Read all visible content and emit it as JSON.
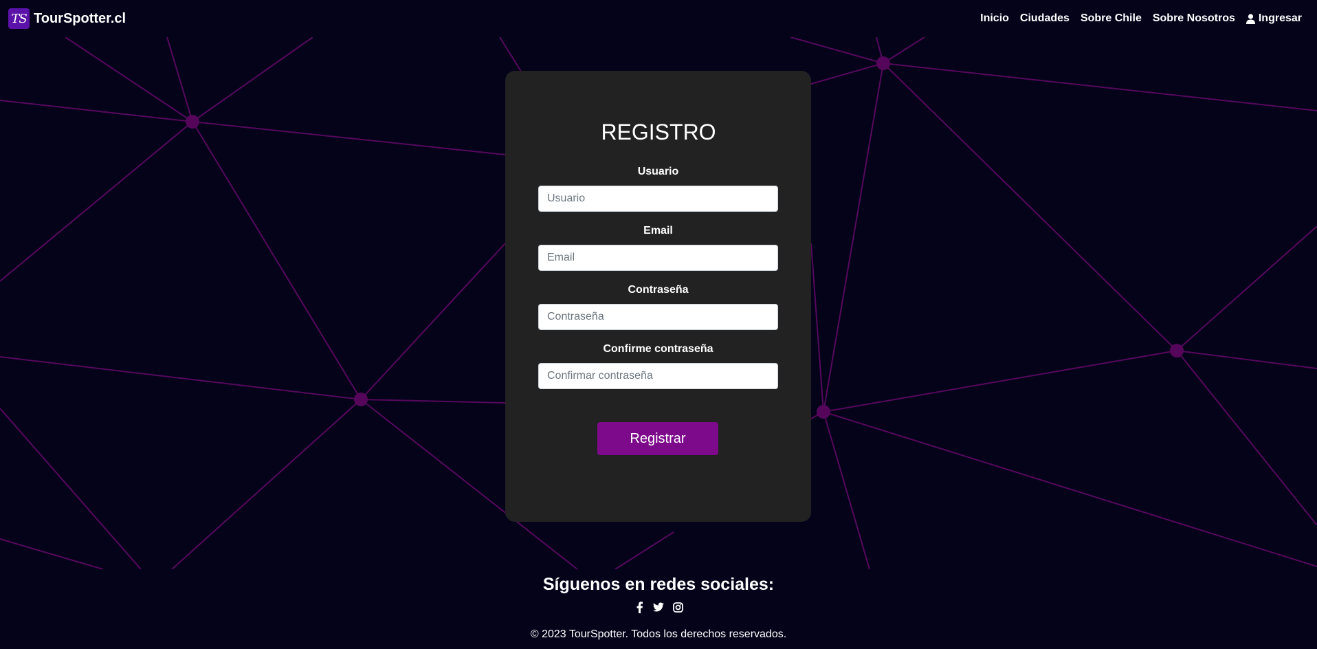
{
  "brand": {
    "logo_text": "TS",
    "name": "TourSpotter.cl"
  },
  "nav": {
    "items": [
      {
        "label": "Inicio"
      },
      {
        "label": "Ciudades"
      },
      {
        "label": "Sobre Chile"
      },
      {
        "label": "Sobre Nosotros"
      }
    ],
    "login_label": "Ingresar"
  },
  "form": {
    "title": "REGISTRO",
    "fields": [
      {
        "label": "Usuario",
        "placeholder": "Usuario",
        "value": ""
      },
      {
        "label": "Email",
        "placeholder": "Email",
        "value": ""
      },
      {
        "label": "Contraseña",
        "placeholder": "Contraseña",
        "value": ""
      },
      {
        "label": "Confirme contraseña",
        "placeholder": "Confirmar contraseña",
        "value": ""
      }
    ],
    "submit_label": "Registrar"
  },
  "footer": {
    "title": "Síguenos en redes sociales:",
    "social_icons": [
      "facebook-icon",
      "twitter-icon",
      "instagram-icon"
    ],
    "copyright": "© 2023 TourSpotter. Todos los derechos reservados."
  },
  "colors": {
    "background": "#04031a",
    "card": "#222222",
    "accent": "#7d0a8b",
    "brand_logo": "#5b12a8",
    "network_line": "#5a0a5e",
    "network_node": "#55065a"
  }
}
